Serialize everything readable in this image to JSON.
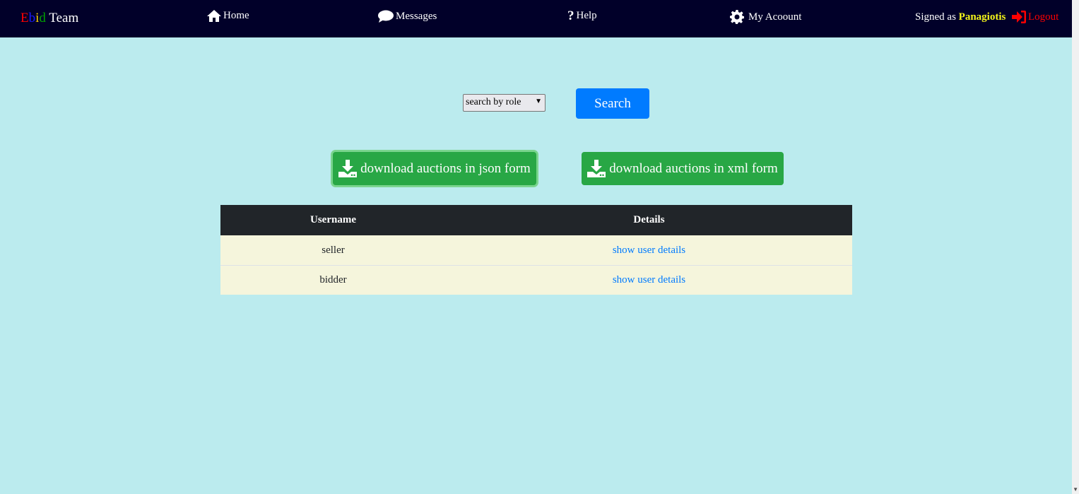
{
  "navbar": {
    "brand_letters": [
      "E",
      "b",
      "i",
      "d"
    ],
    "brand_suffix": "Team",
    "brand_colors": [
      "#ff0000",
      "#1a1aff",
      "#ffd000",
      "#00a000"
    ],
    "home": "Home",
    "messages": "Messages",
    "help": "Help",
    "account": "My Acoount",
    "signed_prefix": "Signed as",
    "username": "Panagiotis",
    "logout": "Logout"
  },
  "search": {
    "select_value": "search by role",
    "button": "Search"
  },
  "downloads": {
    "json": "download auctions in json form",
    "xml": "download auctions in xml form"
  },
  "table": {
    "headers": [
      "Username",
      "Details"
    ],
    "rows": [
      {
        "username": "seller",
        "details": "show user details"
      },
      {
        "username": "bidder",
        "details": "show user details"
      }
    ]
  },
  "colors": {
    "navbar_bg": "#010029",
    "page_bg": "#bbebee",
    "primary": "#007bff",
    "success": "#28a745",
    "row_bg": "#f5f5dc"
  }
}
